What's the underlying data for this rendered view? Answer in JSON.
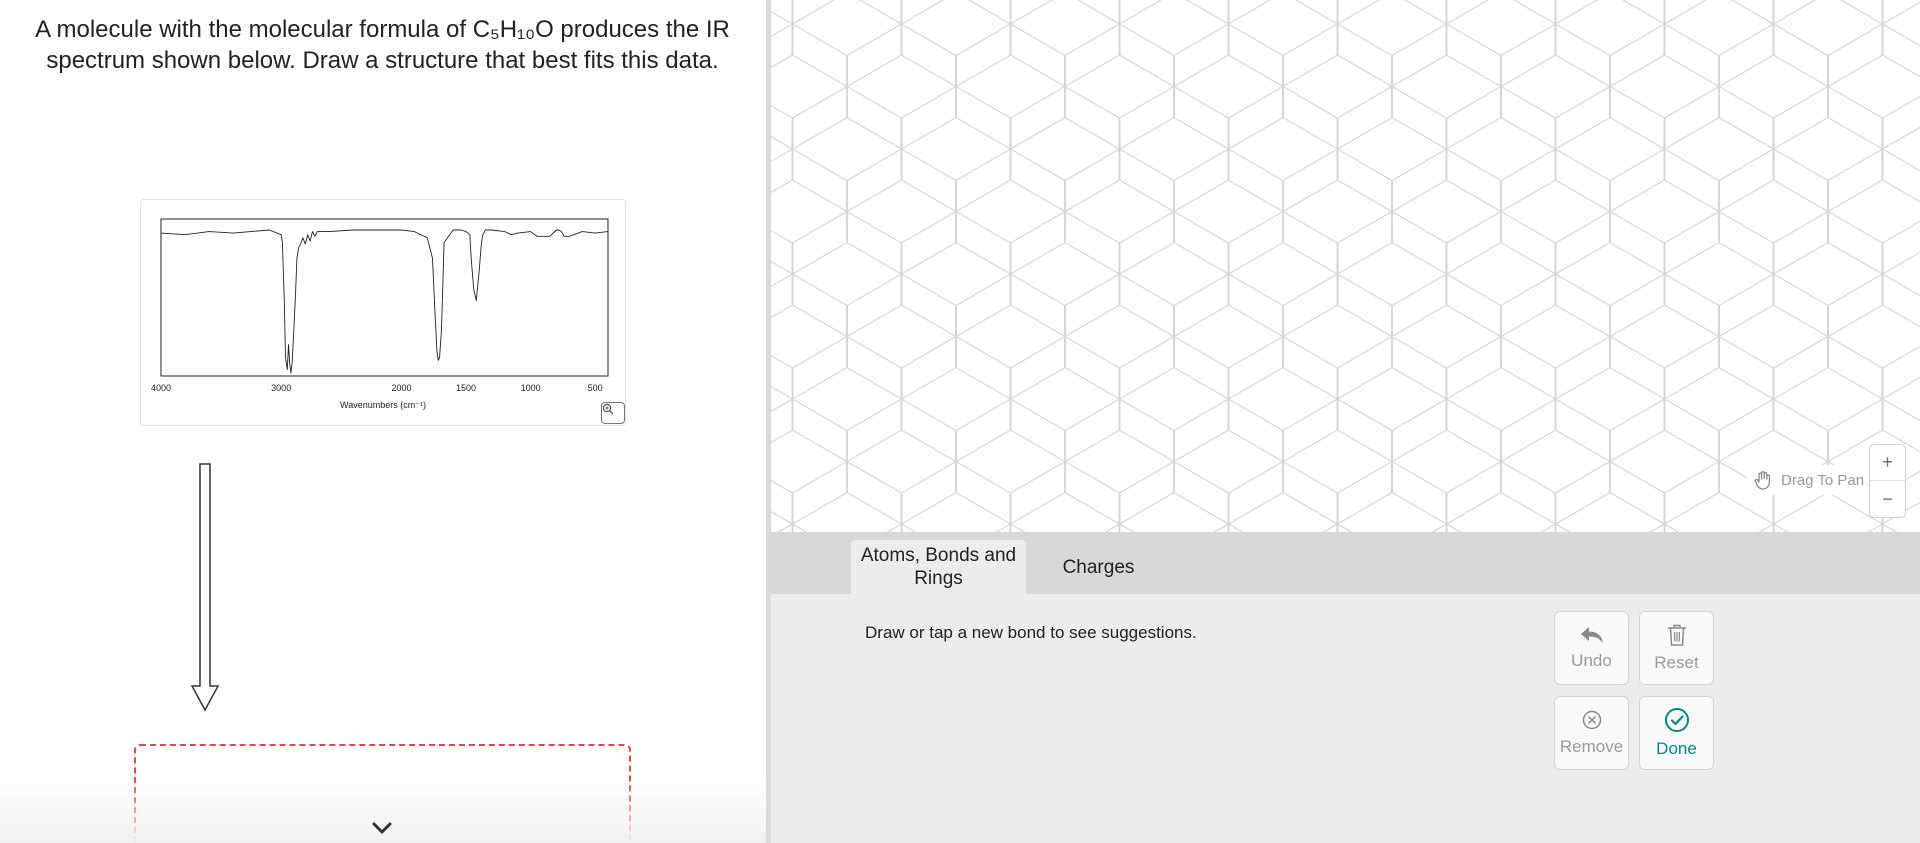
{
  "question": {
    "text": "A molecule with the molecular formula of C₅H₁₀O produces the IR spectrum shown below. Draw a structure that best fits this data."
  },
  "chart_data": {
    "type": "line",
    "title": "",
    "xlabel": "Wavenumbers (cm⁻¹)",
    "ylabel": "",
    "x_ticks": [
      "4000",
      "3000",
      "2000",
      "1500",
      "1000",
      "500"
    ],
    "xlim": [
      4000,
      400
    ],
    "ylim": [
      0,
      100
    ],
    "grid": false,
    "series": [
      {
        "name": "",
        "x": [
          4000,
          3800,
          3600,
          3400,
          3100,
          3000,
          2990,
          2975,
          2965,
          2950,
          2940,
          2930,
          2920,
          2910,
          2895,
          2880,
          2870,
          2855,
          2840,
          2820,
          2800,
          2780,
          2760,
          2740,
          2720,
          2700,
          2600,
          2400,
          2200,
          2000,
          1900,
          1800,
          1760,
          1740,
          1725,
          1715,
          1705,
          1690,
          1670,
          1600,
          1540,
          1500,
          1470,
          1465,
          1455,
          1440,
          1420,
          1400,
          1380,
          1370,
          1350,
          1300,
          1200,
          1150,
          1100,
          1000,
          950,
          850,
          800,
          780,
          760,
          740,
          700,
          600,
          500,
          400
        ],
        "y": [
          91,
          90,
          92,
          91,
          93,
          90,
          85,
          50,
          12,
          4,
          20,
          8,
          2,
          8,
          30,
          55,
          75,
          82,
          84,
          88,
          84,
          90,
          86,
          92,
          89,
          92,
          92,
          93,
          93,
          93,
          92,
          88,
          75,
          40,
          15,
          10,
          12,
          30,
          85,
          93,
          93,
          92,
          90,
          82,
          70,
          55,
          48,
          65,
          85,
          90,
          93,
          93,
          92,
          90,
          91,
          92,
          89,
          89,
          93,
          93,
          92,
          89,
          89,
          92,
          91,
          92
        ]
      }
    ]
  },
  "spectrum": {
    "zoom_icon": "zoom-in-icon"
  },
  "arrow": {
    "icon": "down-arrow-icon"
  },
  "scroll": {
    "icon": "chevron-down-icon"
  },
  "canvas": {
    "drag_hint": "Drag To Pan",
    "drag_icon": "hand-icon",
    "zoom_in": "+",
    "zoom_out": "−"
  },
  "tabs": [
    {
      "label": "Atoms, Bonds and Rings",
      "active": true
    },
    {
      "label": "Charges",
      "active": false
    }
  ],
  "suggestion": "Draw or tap a new bond to see suggestions.",
  "actions": {
    "undo": "Undo",
    "reset": "Reset",
    "remove": "Remove",
    "done": "Done"
  },
  "colors": {
    "accent": "#00897b",
    "answer_border": "#e8463c",
    "grid_line": "#d6d6d6"
  }
}
